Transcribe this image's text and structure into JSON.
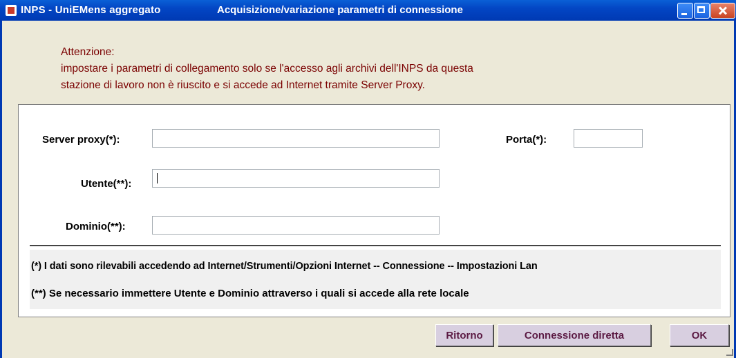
{
  "window": {
    "title_app": "INPS - UniEMens aggregato",
    "title_sub": "Acquisizione/variazione parametri di connessione"
  },
  "warning": {
    "heading": "Attenzione:",
    "line1": "impostare i parametri di collegamento solo se l'accesso agli archivi dell'INPS da questa",
    "line2": "stazione di lavoro non è riuscito e si accede ad Internet tramite Server Proxy."
  },
  "form": {
    "server_proxy": {
      "label": "Server proxy(*):",
      "value": ""
    },
    "porta": {
      "label": "Porta(*):",
      "value": ""
    },
    "utente": {
      "label": "Utente(**):",
      "value": ""
    },
    "dominio": {
      "label": "Dominio(**):",
      "value": ""
    }
  },
  "notes": {
    "note1": "(*) I dati sono rilevabili accedendo ad Internet/Strumenti/Opzioni Internet  -- Connessione  -- Impostazioni Lan",
    "note2": "(**) Se necessario immettere Utente e Dominio attraverso i quali si accede alla rete locale"
  },
  "buttons": {
    "ritorno": "Ritorno",
    "connessione_diretta": "Connessione diretta",
    "ok": "OK"
  },
  "colors": {
    "titlebar": "#0346c4",
    "warning_text": "#7a0000",
    "button_bg": "#d8cfe0",
    "button_text": "#5b1a43",
    "window_bg": "#ece9d8"
  }
}
